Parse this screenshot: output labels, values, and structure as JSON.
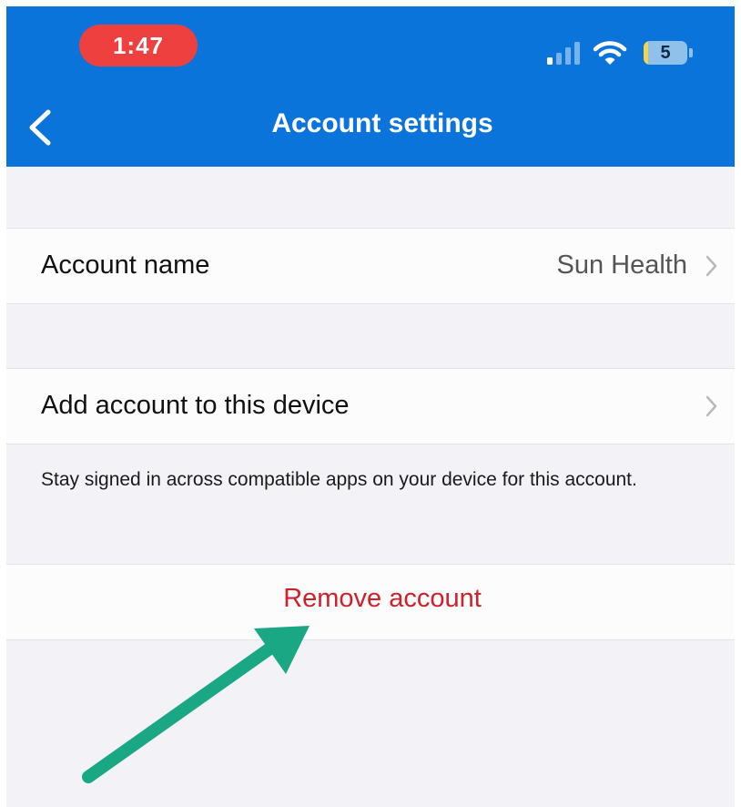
{
  "status_bar": {
    "time": "1:47",
    "battery_level": "5",
    "icons": [
      "cellular-signal-icon",
      "wifi-icon",
      "battery-icon"
    ]
  },
  "nav": {
    "back_icon": "chevron-left-icon",
    "title": "Account settings"
  },
  "account_name_row": {
    "label": "Account name",
    "value": "Sun Health",
    "icon": "chevron-right-icon"
  },
  "add_account_row": {
    "label": "Add account to this device",
    "icon": "chevron-right-icon",
    "description": "Stay signed in across compatible apps on your device for this account."
  },
  "remove_account": {
    "label": "Remove account"
  },
  "annotation": {
    "icon": "annotation-arrow-icon",
    "color": "#1aa784"
  },
  "colors": {
    "header": "#0a74da",
    "time_pill": "#ef4040",
    "destructive": "#d0202a",
    "background": "#f3f2f7"
  }
}
